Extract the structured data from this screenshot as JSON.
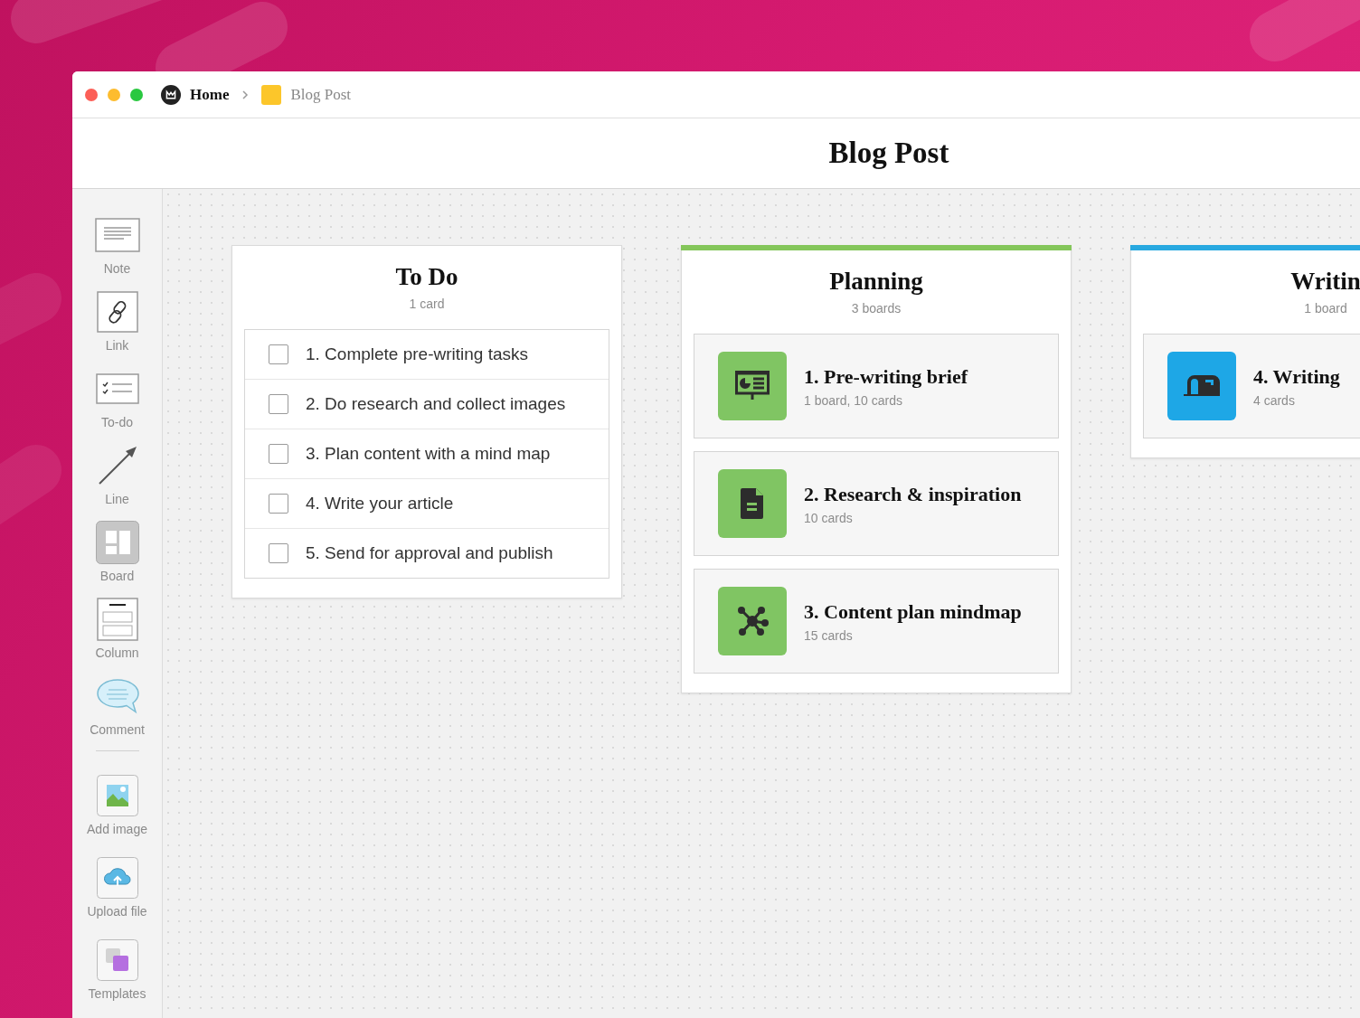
{
  "breadcrumb": [
    {
      "label": "Home",
      "kind": "home"
    },
    {
      "label": "Blog Post",
      "kind": "board"
    }
  ],
  "title": "Blog Post",
  "sidebar": {
    "tools": [
      {
        "label": "Note",
        "kind": "note"
      },
      {
        "label": "Link",
        "kind": "link"
      },
      {
        "label": "To-do",
        "kind": "todo"
      },
      {
        "label": "Line",
        "kind": "line"
      },
      {
        "label": "Board",
        "kind": "board"
      },
      {
        "label": "Column",
        "kind": "column"
      },
      {
        "label": "Comment",
        "kind": "comment"
      }
    ],
    "extras": [
      {
        "label": "Add image",
        "kind": "image"
      },
      {
        "label": "Upload file",
        "kind": "upload"
      },
      {
        "label": "Templates",
        "kind": "templates"
      }
    ]
  },
  "columns": [
    {
      "title": "To Do",
      "subtitle": "1 card",
      "kind": "todo",
      "items": [
        {
          "text": "1. Complete pre-writing tasks",
          "checked": false
        },
        {
          "text": "2. Do research and collect images",
          "checked": false
        },
        {
          "text": "3. Plan content with a mind map",
          "checked": false
        },
        {
          "text": "4. Write your article",
          "checked": false
        },
        {
          "text": "5. Send for approval and publish",
          "checked": false
        }
      ]
    },
    {
      "title": "Planning",
      "subtitle": "3 boards",
      "kind": "boards",
      "color": "#84c65a",
      "boards": [
        {
          "title": "1. Pre-writing brief",
          "meta": "1 board, 10 cards",
          "kind": "presentation",
          "color": "#80c563"
        },
        {
          "title": "2. Research & inspiration",
          "meta": "10 cards",
          "kind": "document",
          "color": "#80c563"
        },
        {
          "title": "3. Content plan mindmap",
          "meta": "15 cards",
          "kind": "mindmap",
          "color": "#80c563"
        }
      ]
    },
    {
      "title": "Writin",
      "subtitle": "1 board",
      "kind": "boards",
      "color": "#27a8e0",
      "boards": [
        {
          "title": "4. Writing",
          "meta": "4 cards",
          "kind": "mailbox",
          "color": "#1ea7e6"
        }
      ]
    }
  ]
}
